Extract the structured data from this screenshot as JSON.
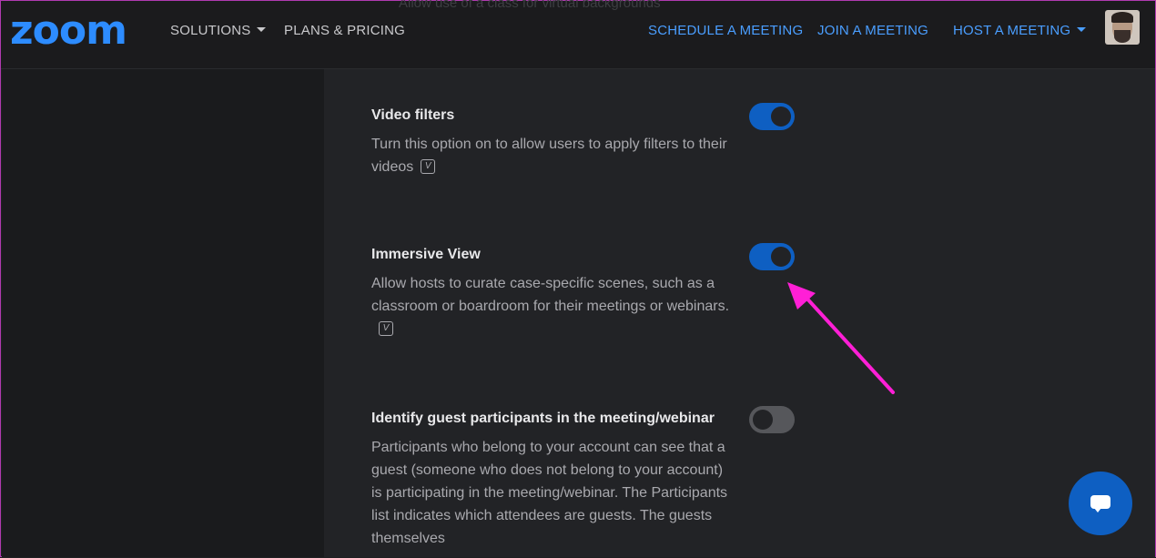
{
  "nav": {
    "logo": "zoom",
    "solutions": "SOLUTIONS",
    "plans": "PLANS & PRICING",
    "schedule": "SCHEDULE A MEETING",
    "join": "JOIN A MEETING",
    "host": "HOST A MEETING",
    "ghost_text": "Allow use of a class for virtual backgrounds"
  },
  "settings": [
    {
      "title": "Video filters",
      "desc": "Turn this option on to allow users to apply filters to their videos",
      "enabled": true
    },
    {
      "title": "Immersive View",
      "desc": "Allow hosts to curate case-specific scenes, such as a classroom or boardroom for their meetings or webinars.",
      "enabled": true
    },
    {
      "title": "Identify guest participants in the meeting/webinar",
      "desc": "Participants who belong to your account can see that a guest (someone who does not belong to your account) is participating in the meeting/webinar. The Participants list indicates which attendees are guests. The guests themselves",
      "enabled": false
    }
  ],
  "colors": {
    "accent": "#2d8cff",
    "toggle_on": "#0e5fc2",
    "annotation_arrow": "#ff1fd6"
  },
  "icons": {
    "video_badge": "V",
    "chat": "chat-icon"
  }
}
